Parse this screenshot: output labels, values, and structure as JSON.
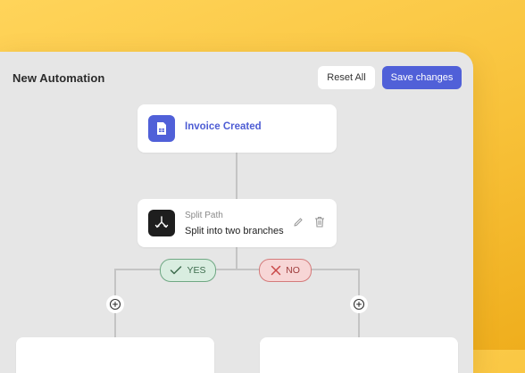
{
  "header": {
    "title": "New Automation",
    "reset_label": "Reset All",
    "save_label": "Save changes"
  },
  "trigger": {
    "label": "Invoice Created",
    "icon": "invoice-icon"
  },
  "split": {
    "type_label": "Split Path",
    "description": "Split into two branches",
    "icon": "split-path-icon"
  },
  "branches": {
    "yes_label": "YES",
    "no_label": "NO"
  },
  "colors": {
    "accent": "#5060d8",
    "yes": "#3d6c4d",
    "no": "#9c3b3b"
  }
}
